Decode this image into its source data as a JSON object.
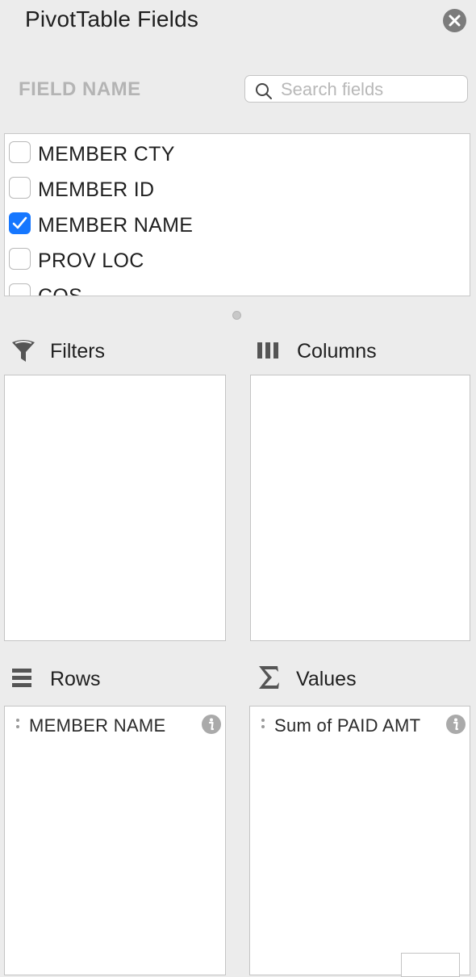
{
  "header": {
    "title": "PivotTable Fields"
  },
  "field_section": {
    "label": "FIELD NAME"
  },
  "search": {
    "placeholder": "Search fields",
    "value": ""
  },
  "fields": [
    {
      "label": "MEMBER CTY",
      "checked": false
    },
    {
      "label": "MEMBER ID",
      "checked": false
    },
    {
      "label": "MEMBER NAME",
      "checked": true
    },
    {
      "label": "PROV LOC",
      "checked": false
    },
    {
      "label": "COS",
      "checked": false
    }
  ],
  "areas": {
    "filters": {
      "label": "Filters",
      "icon": "filter-icon",
      "items": []
    },
    "columns": {
      "label": "Columns",
      "icon": "columns-icon",
      "items": []
    },
    "rows": {
      "label": "Rows",
      "icon": "rows-icon",
      "items": [
        {
          "label": "MEMBER NAME"
        }
      ]
    },
    "values": {
      "label": "Values",
      "icon": "sigma-icon",
      "items": [
        {
          "label": "Sum of PAID AMT"
        }
      ]
    }
  },
  "colors": {
    "check_accent": "#1677ff",
    "panel_bg": "#ececec"
  }
}
